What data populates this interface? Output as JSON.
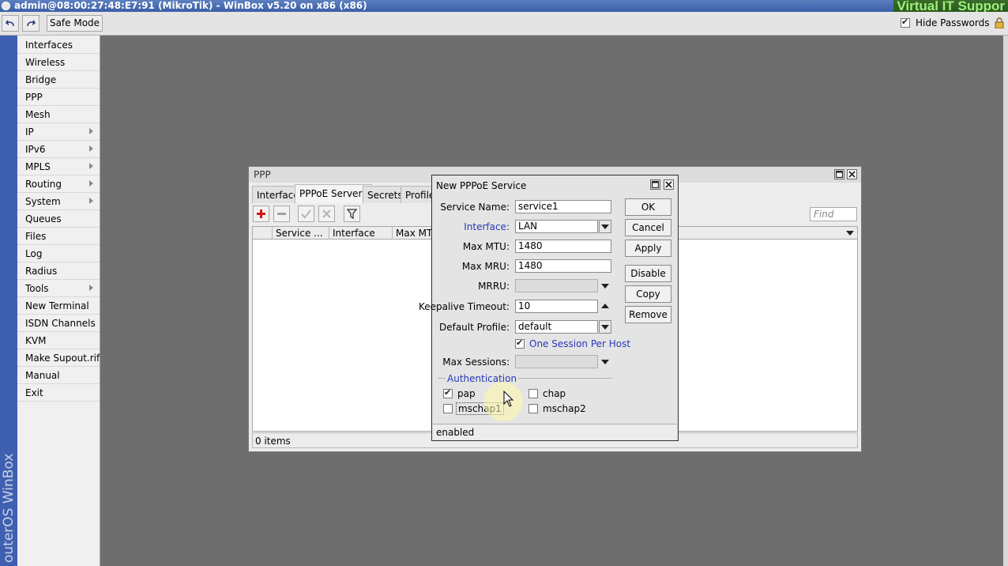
{
  "window": {
    "title": "admin@08:00:27:48:E7:91 (MikroTik) - WinBox v5.20 on x86 (x86)",
    "brand": "Virtual IT Suppor"
  },
  "toolbar": {
    "safe_mode": "Safe Mode",
    "hide_passwords": "Hide Passwords",
    "hide_passwords_checked": true
  },
  "sidebar": {
    "vertical_label": "outerOS WinBox",
    "items": [
      {
        "label": "Interfaces",
        "submenu": false
      },
      {
        "label": "Wireless",
        "submenu": false
      },
      {
        "label": "Bridge",
        "submenu": false
      },
      {
        "label": "PPP",
        "submenu": false
      },
      {
        "label": "Mesh",
        "submenu": false
      },
      {
        "label": "IP",
        "submenu": true
      },
      {
        "label": "IPv6",
        "submenu": true
      },
      {
        "label": "MPLS",
        "submenu": true
      },
      {
        "label": "Routing",
        "submenu": true
      },
      {
        "label": "System",
        "submenu": true
      },
      {
        "label": "Queues",
        "submenu": false
      },
      {
        "label": "Files",
        "submenu": false
      },
      {
        "label": "Log",
        "submenu": false
      },
      {
        "label": "Radius",
        "submenu": false
      },
      {
        "label": "Tools",
        "submenu": true
      },
      {
        "label": "New Terminal",
        "submenu": false
      },
      {
        "label": "ISDN Channels",
        "submenu": false
      },
      {
        "label": "KVM",
        "submenu": false
      },
      {
        "label": "Make Supout.rif",
        "submenu": false
      },
      {
        "label": "Manual",
        "submenu": false
      },
      {
        "label": "Exit",
        "submenu": false
      }
    ]
  },
  "ppp": {
    "title": "PPP",
    "tabs": [
      "Interface",
      "PPPoE Servers",
      "Secrets",
      "Profiles"
    ],
    "active_tab": "PPPoE Servers",
    "find_placeholder": "Find",
    "columns": [
      "Service ...",
      "Interface",
      "Max MTU"
    ],
    "status": "0 items"
  },
  "dialog": {
    "title": "New PPPoE Service",
    "fields": {
      "service_name": {
        "label": "Service Name:",
        "value": "service1"
      },
      "interface": {
        "label": "Interface:",
        "value": "LAN"
      },
      "max_mtu": {
        "label": "Max MTU:",
        "value": "1480"
      },
      "max_mru": {
        "label": "Max MRU:",
        "value": "1480"
      },
      "mrru": {
        "label": "MRRU:",
        "value": ""
      },
      "keepalive_timeout": {
        "label": "Keepalive Timeout:",
        "value": "10"
      },
      "default_profile": {
        "label": "Default Profile:",
        "value": "default"
      },
      "one_session_per_host": {
        "label": "One Session Per Host",
        "checked": true
      },
      "max_sessions": {
        "label": "Max Sessions:",
        "value": ""
      }
    },
    "authentication": {
      "title": "Authentication",
      "pap": {
        "label": "pap",
        "checked": true
      },
      "chap": {
        "label": "chap",
        "checked": false
      },
      "mschap1": {
        "label": "mschap1",
        "checked": false
      },
      "mschap2": {
        "label": "mschap2",
        "checked": false
      }
    },
    "buttons": {
      "ok": "OK",
      "cancel": "Cancel",
      "apply": "Apply",
      "disable": "Disable",
      "copy": "Copy",
      "remove": "Remove"
    },
    "status": "enabled"
  },
  "colors": {
    "titlebar": "#3a5fa8",
    "sidebar_strip": "#3f5fb0",
    "link_label": "#2838b8",
    "desktop": "#6e6e6e"
  }
}
